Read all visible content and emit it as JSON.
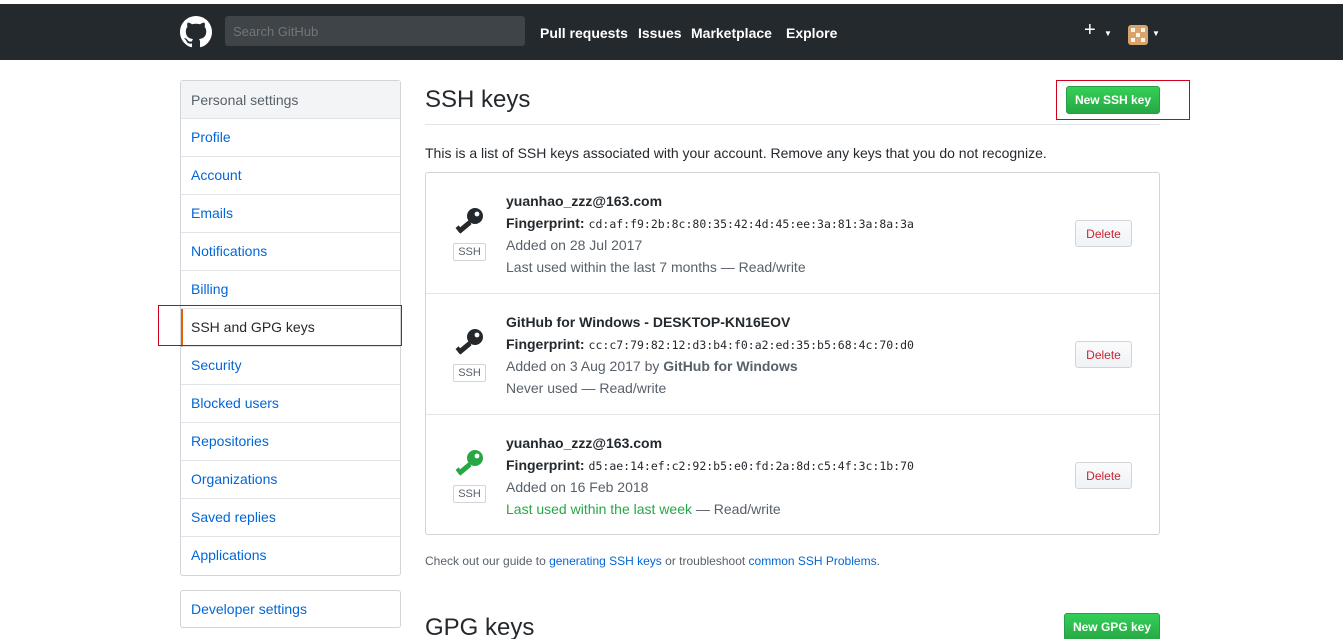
{
  "header": {
    "search_placeholder": "Search GitHub",
    "nav": [
      "Pull requests",
      "Issues",
      "Marketplace",
      "Explore"
    ],
    "plus_label": "+"
  },
  "sidebar": {
    "heading": "Personal settings",
    "items": [
      {
        "label": "Profile"
      },
      {
        "label": "Account"
      },
      {
        "label": "Emails"
      },
      {
        "label": "Notifications"
      },
      {
        "label": "Billing"
      },
      {
        "label": "SSH and GPG keys",
        "active": true
      },
      {
        "label": "Security"
      },
      {
        "label": "Blocked users"
      },
      {
        "label": "Repositories"
      },
      {
        "label": "Organizations"
      },
      {
        "label": "Saved replies"
      },
      {
        "label": "Applications"
      }
    ],
    "developer_settings": "Developer settings"
  },
  "ssh": {
    "title": "SSH keys",
    "new_button": "New SSH key",
    "intro": "This is a list of SSH keys associated with your account. Remove any keys that you do not recognize.",
    "fingerprint_label": "Fingerprint:",
    "badge": "SSH",
    "delete_label": "Delete",
    "keys": [
      {
        "title": "yuanhao_zzz@163.com",
        "fingerprint": "cd:af:f9:2b:8c:80:35:42:4d:45:ee:3a:81:3a:8a:3a",
        "added": "Added on 28 Jul 2017",
        "added_by": "",
        "used": "Last used within the last 7 months",
        "used_suffix": " — Read/write",
        "icon_color": "#24292e"
      },
      {
        "title": "GitHub for Windows - DESKTOP-KN16EOV",
        "fingerprint": "cc:c7:79:82:12:d3:b4:f0:a2:ed:35:b5:68:4c:70:d0",
        "added": "Added on 3 Aug 2017 by ",
        "added_by": "GitHub for Windows",
        "used": "Never used",
        "used_suffix": " — Read/write",
        "icon_color": "#24292e"
      },
      {
        "title": "yuanhao_zzz@163.com",
        "fingerprint": "d5:ae:14:ef:c2:92:b5:e0:fd:2a:8d:c5:4f:3c:1b:70",
        "added": "Added on 16 Feb 2018",
        "added_by": "",
        "used": "Last used within the last week",
        "used_suffix": " — Read/write",
        "icon_color": "#28a745"
      }
    ],
    "guide_prefix": "Check out our guide to ",
    "guide_link1": "generating SSH keys",
    "guide_mid": " or troubleshoot ",
    "guide_link2": "common SSH Problems",
    "guide_suffix": "."
  },
  "gpg": {
    "title": "GPG keys",
    "new_button": "New GPG key"
  },
  "colors": {
    "header_bg": "#24292e",
    "link": "#0366d6",
    "green": "#28a745",
    "danger": "#cb2431",
    "highlight_box": "#d0021b"
  }
}
